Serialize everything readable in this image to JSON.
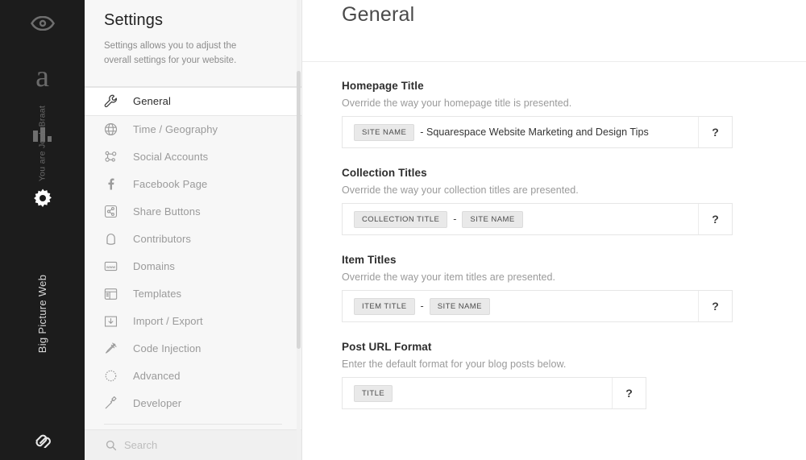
{
  "rail": {
    "icons": [
      {
        "name": "eye-icon",
        "label": "Preview"
      },
      {
        "name": "letter-a-icon",
        "label": "Design"
      },
      {
        "name": "bar-chart-icon",
        "label": "Analytics"
      },
      {
        "name": "gear-icon",
        "label": "Settings"
      }
    ],
    "logo_label": "Squarespace",
    "user_text": "You are Josh Braat",
    "site_text": "Big Picture Web"
  },
  "panel": {
    "title": "Settings",
    "description": "Settings allows you to adjust the overall settings for your website.",
    "nav": [
      {
        "label": "General",
        "icon": "wrench-icon",
        "active": true
      },
      {
        "label": "Time / Geography",
        "icon": "globe-icon",
        "active": false
      },
      {
        "label": "Social Accounts",
        "icon": "social-dots-icon",
        "active": false
      },
      {
        "label": "Facebook Page",
        "icon": "facebook-icon",
        "active": false
      },
      {
        "label": "Share Buttons",
        "icon": "share-icon",
        "active": false
      },
      {
        "label": "Contributors",
        "icon": "person-icon",
        "active": false
      },
      {
        "label": "Domains",
        "icon": "www-icon",
        "active": false
      },
      {
        "label": "Templates",
        "icon": "template-icon",
        "active": false
      },
      {
        "label": "Import / Export",
        "icon": "download-icon",
        "active": false
      },
      {
        "label": "Code Injection",
        "icon": "syringe-icon",
        "active": false
      },
      {
        "label": "Advanced",
        "icon": "dashed-circle-icon",
        "active": false
      },
      {
        "label": "Developer",
        "icon": "hammer-icon",
        "active": false
      }
    ],
    "search_placeholder": "Search"
  },
  "main": {
    "title": "General",
    "fields": [
      {
        "label": "Homepage Title",
        "description": "Override the way your homepage title is presented.",
        "parts": [
          {
            "kind": "token",
            "text": "SITE NAME"
          },
          {
            "kind": "plain",
            "text": "- Squarespace Website Marketing and Design Tips"
          }
        ],
        "help": "?"
      },
      {
        "label": "Collection Titles",
        "description": "Override the way your collection titles are presented.",
        "parts": [
          {
            "kind": "token",
            "text": "COLLECTION TITLE"
          },
          {
            "kind": "dash",
            "text": "-"
          },
          {
            "kind": "token",
            "text": "SITE NAME"
          }
        ],
        "help": "?"
      },
      {
        "label": "Item Titles",
        "description": "Override the way your item titles are presented.",
        "parts": [
          {
            "kind": "token",
            "text": "ITEM TITLE"
          },
          {
            "kind": "dash",
            "text": "-"
          },
          {
            "kind": "token",
            "text": "SITE NAME"
          }
        ],
        "help": "?"
      },
      {
        "label": "Post URL Format",
        "description": "Enter the default format for your blog posts below.",
        "narrow": true,
        "parts": [
          {
            "kind": "token",
            "text": "TITLE"
          }
        ],
        "help": "?"
      }
    ]
  },
  "colors": {
    "rail_bg": "#1c1c1c",
    "panel_bg": "#f7f7f7",
    "token_bg": "#e9e9e9",
    "active_text": "#2c2c2c",
    "muted_text": "#9a9a9a"
  }
}
